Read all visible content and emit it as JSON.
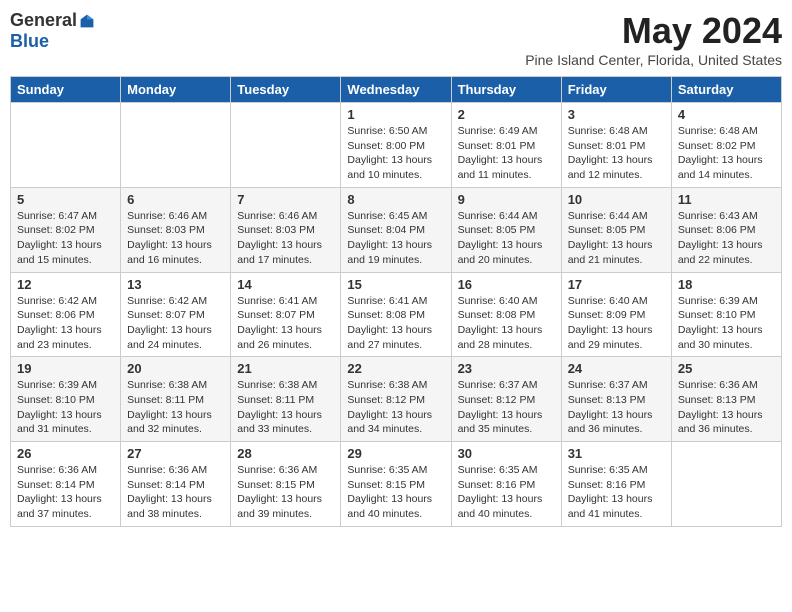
{
  "header": {
    "logo_general": "General",
    "logo_blue": "Blue",
    "month_title": "May 2024",
    "location": "Pine Island Center, Florida, United States"
  },
  "days_of_week": [
    "Sunday",
    "Monday",
    "Tuesday",
    "Wednesday",
    "Thursday",
    "Friday",
    "Saturday"
  ],
  "weeks": [
    [
      {
        "day": "",
        "info": ""
      },
      {
        "day": "",
        "info": ""
      },
      {
        "day": "",
        "info": ""
      },
      {
        "day": "1",
        "info": "Sunrise: 6:50 AM\nSunset: 8:00 PM\nDaylight: 13 hours\nand 10 minutes."
      },
      {
        "day": "2",
        "info": "Sunrise: 6:49 AM\nSunset: 8:01 PM\nDaylight: 13 hours\nand 11 minutes."
      },
      {
        "day": "3",
        "info": "Sunrise: 6:48 AM\nSunset: 8:01 PM\nDaylight: 13 hours\nand 12 minutes."
      },
      {
        "day": "4",
        "info": "Sunrise: 6:48 AM\nSunset: 8:02 PM\nDaylight: 13 hours\nand 14 minutes."
      }
    ],
    [
      {
        "day": "5",
        "info": "Sunrise: 6:47 AM\nSunset: 8:02 PM\nDaylight: 13 hours\nand 15 minutes."
      },
      {
        "day": "6",
        "info": "Sunrise: 6:46 AM\nSunset: 8:03 PM\nDaylight: 13 hours\nand 16 minutes."
      },
      {
        "day": "7",
        "info": "Sunrise: 6:46 AM\nSunset: 8:03 PM\nDaylight: 13 hours\nand 17 minutes."
      },
      {
        "day": "8",
        "info": "Sunrise: 6:45 AM\nSunset: 8:04 PM\nDaylight: 13 hours\nand 19 minutes."
      },
      {
        "day": "9",
        "info": "Sunrise: 6:44 AM\nSunset: 8:05 PM\nDaylight: 13 hours\nand 20 minutes."
      },
      {
        "day": "10",
        "info": "Sunrise: 6:44 AM\nSunset: 8:05 PM\nDaylight: 13 hours\nand 21 minutes."
      },
      {
        "day": "11",
        "info": "Sunrise: 6:43 AM\nSunset: 8:06 PM\nDaylight: 13 hours\nand 22 minutes."
      }
    ],
    [
      {
        "day": "12",
        "info": "Sunrise: 6:42 AM\nSunset: 8:06 PM\nDaylight: 13 hours\nand 23 minutes."
      },
      {
        "day": "13",
        "info": "Sunrise: 6:42 AM\nSunset: 8:07 PM\nDaylight: 13 hours\nand 24 minutes."
      },
      {
        "day": "14",
        "info": "Sunrise: 6:41 AM\nSunset: 8:07 PM\nDaylight: 13 hours\nand 26 minutes."
      },
      {
        "day": "15",
        "info": "Sunrise: 6:41 AM\nSunset: 8:08 PM\nDaylight: 13 hours\nand 27 minutes."
      },
      {
        "day": "16",
        "info": "Sunrise: 6:40 AM\nSunset: 8:08 PM\nDaylight: 13 hours\nand 28 minutes."
      },
      {
        "day": "17",
        "info": "Sunrise: 6:40 AM\nSunset: 8:09 PM\nDaylight: 13 hours\nand 29 minutes."
      },
      {
        "day": "18",
        "info": "Sunrise: 6:39 AM\nSunset: 8:10 PM\nDaylight: 13 hours\nand 30 minutes."
      }
    ],
    [
      {
        "day": "19",
        "info": "Sunrise: 6:39 AM\nSunset: 8:10 PM\nDaylight: 13 hours\nand 31 minutes."
      },
      {
        "day": "20",
        "info": "Sunrise: 6:38 AM\nSunset: 8:11 PM\nDaylight: 13 hours\nand 32 minutes."
      },
      {
        "day": "21",
        "info": "Sunrise: 6:38 AM\nSunset: 8:11 PM\nDaylight: 13 hours\nand 33 minutes."
      },
      {
        "day": "22",
        "info": "Sunrise: 6:38 AM\nSunset: 8:12 PM\nDaylight: 13 hours\nand 34 minutes."
      },
      {
        "day": "23",
        "info": "Sunrise: 6:37 AM\nSunset: 8:12 PM\nDaylight: 13 hours\nand 35 minutes."
      },
      {
        "day": "24",
        "info": "Sunrise: 6:37 AM\nSunset: 8:13 PM\nDaylight: 13 hours\nand 36 minutes."
      },
      {
        "day": "25",
        "info": "Sunrise: 6:36 AM\nSunset: 8:13 PM\nDaylight: 13 hours\nand 36 minutes."
      }
    ],
    [
      {
        "day": "26",
        "info": "Sunrise: 6:36 AM\nSunset: 8:14 PM\nDaylight: 13 hours\nand 37 minutes."
      },
      {
        "day": "27",
        "info": "Sunrise: 6:36 AM\nSunset: 8:14 PM\nDaylight: 13 hours\nand 38 minutes."
      },
      {
        "day": "28",
        "info": "Sunrise: 6:36 AM\nSunset: 8:15 PM\nDaylight: 13 hours\nand 39 minutes."
      },
      {
        "day": "29",
        "info": "Sunrise: 6:35 AM\nSunset: 8:15 PM\nDaylight: 13 hours\nand 40 minutes."
      },
      {
        "day": "30",
        "info": "Sunrise: 6:35 AM\nSunset: 8:16 PM\nDaylight: 13 hours\nand 40 minutes."
      },
      {
        "day": "31",
        "info": "Sunrise: 6:35 AM\nSunset: 8:16 PM\nDaylight: 13 hours\nand 41 minutes."
      },
      {
        "day": "",
        "info": ""
      }
    ]
  ]
}
